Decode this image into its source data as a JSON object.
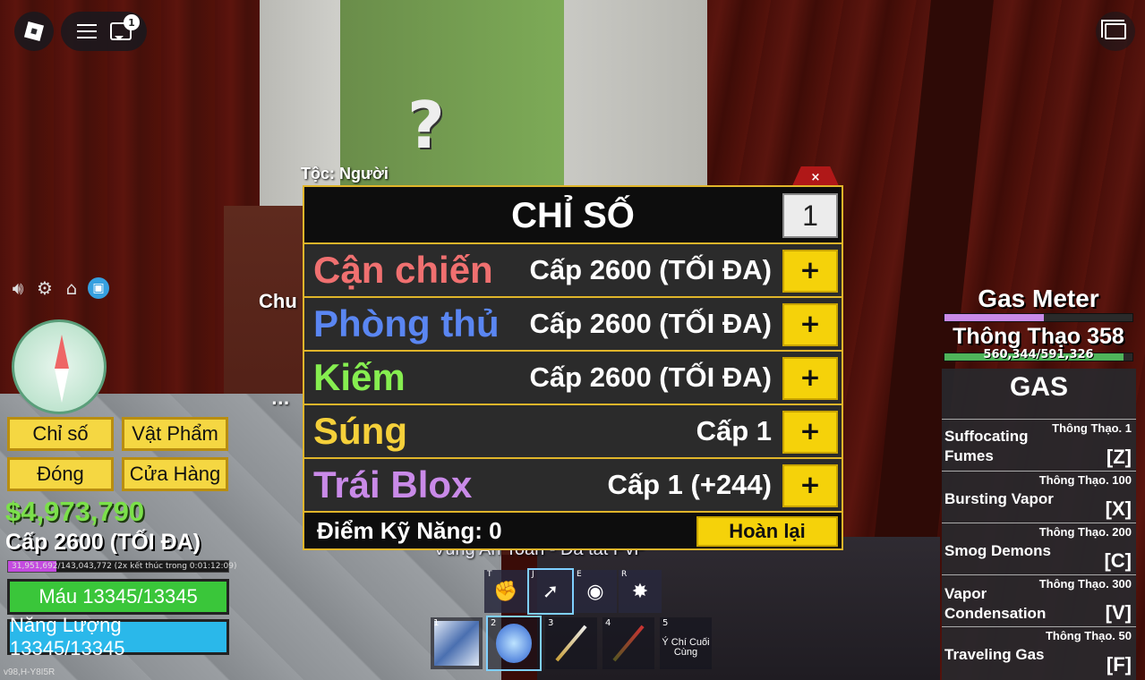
{
  "scene": {
    "npc_label": "Tộc: Người",
    "side_label": "Chu",
    "ellipsis": "...",
    "safe_zone_text": "Vùng An Toàn - Đã tắt PvP",
    "question_mark": "?"
  },
  "top_bar": {
    "chat_badge": "1"
  },
  "menu": {
    "stats_label": "Chỉ số",
    "items_label": "Vật Phẩm",
    "close_label": "Đóng",
    "shop_label": "Cửa Hàng"
  },
  "player": {
    "money": "$4,973,790",
    "level": "Cấp 2600 (TỐI ĐA)",
    "xp_text": "31,951,692/143,043,772 (2x kết thúc trong 0:01:12:09)",
    "xp_fraction": 0.22,
    "health": "Máu 13345/13345",
    "energy": "Năng Lượng 13345/13345",
    "version": "v98,H-Y8I5R"
  },
  "stats_panel": {
    "title": "CHỈ SỐ",
    "points_input": "1",
    "close_symbol": "×",
    "rows": [
      {
        "name": "Cận chiến",
        "value": "Cấp 2600 (TỐI ĐA)",
        "color": "#f07070"
      },
      {
        "name": "Phòng thủ",
        "value": "Cấp 2600 (TỐI ĐA)",
        "color": "#5a86f2"
      },
      {
        "name": "Kiếm",
        "value": "Cấp 2600 (TỐI ĐA)",
        "color": "#86ee50"
      },
      {
        "name": "Súng",
        "value": "Cấp 1",
        "color": "#f5d03a"
      },
      {
        "name": "Trái Blox",
        "value": "Cấp 1 (+244)",
        "color": "#c98ae8"
      }
    ],
    "plus_label": "+",
    "skill_points": "Điểm Kỹ Năng: 0",
    "reset_label": "Hoàn lại"
  },
  "gas": {
    "meter_title": "Gas Meter",
    "meter_fraction": 0.53,
    "fighting_style": "Thông Thạo 358",
    "mastery_text": "560,344/591,326",
    "mastery_fraction": 0.95,
    "panel_title": "GAS",
    "skills": [
      {
        "name": "Suffocating Fumes",
        "req": "Thông Thạo. 1",
        "key": "[Z]"
      },
      {
        "name": "Bursting Vapor",
        "req": "Thông Thạo. 100",
        "key": "[X]"
      },
      {
        "name": "Smog Demons",
        "req": "Thông Thạo. 200",
        "key": "[C]"
      },
      {
        "name": "Vapor Condensation",
        "req": "Thông Thạo. 300",
        "key": "[V]"
      },
      {
        "name": "Traveling Gas",
        "req": "Thông Thạo. 50",
        "key": "[F]"
      }
    ]
  },
  "hotbar": {
    "move_keys": [
      "T",
      "J",
      "E",
      "R"
    ],
    "slots": [
      "1",
      "2",
      "3",
      "4",
      "5"
    ],
    "slot5_label": "Ý Chí Cuối Cùng"
  },
  "colors": {
    "accent_gold": "#e0b52a",
    "button_yellow": "#f5d20a",
    "health_green": "#3ac63a",
    "energy_blue": "#2ab8ea",
    "money_green": "#7be04a"
  },
  "icons": {
    "roblox": "roblox-logo-icon",
    "menu": "hamburger-menu-icon",
    "chat": "chat-icon",
    "window": "window-icon",
    "sound": "speaker-icon",
    "settings": "gear-icon",
    "home": "house-icon",
    "gift": "gift-icon",
    "compass": "compass-icon"
  }
}
